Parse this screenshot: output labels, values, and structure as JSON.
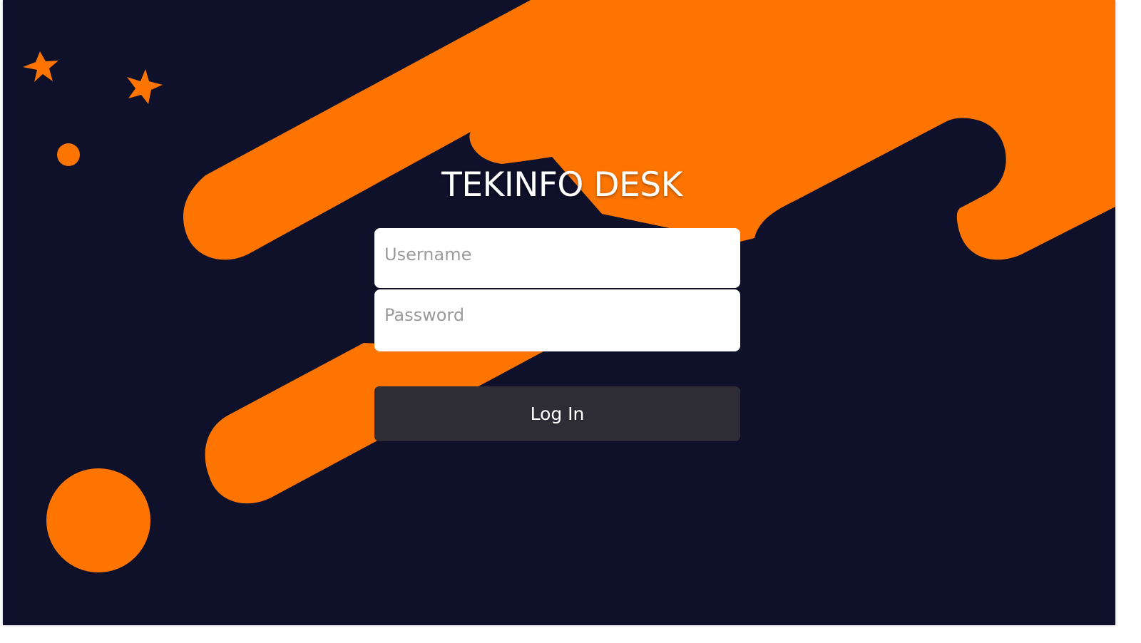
{
  "app": {
    "title": "TEKINFO DESK"
  },
  "form": {
    "username_placeholder": "Username",
    "password_placeholder": "Password",
    "username_value": "",
    "password_value": "",
    "login_label": "Log In"
  },
  "colors": {
    "background": "#0f1029",
    "accent": "#fd7500",
    "button": "#2e2d36",
    "text": "#ffffff"
  },
  "decorations": {
    "stars": [
      "star-icon",
      "star-icon"
    ],
    "dots": [
      "circle-icon",
      "circle-icon"
    ]
  }
}
